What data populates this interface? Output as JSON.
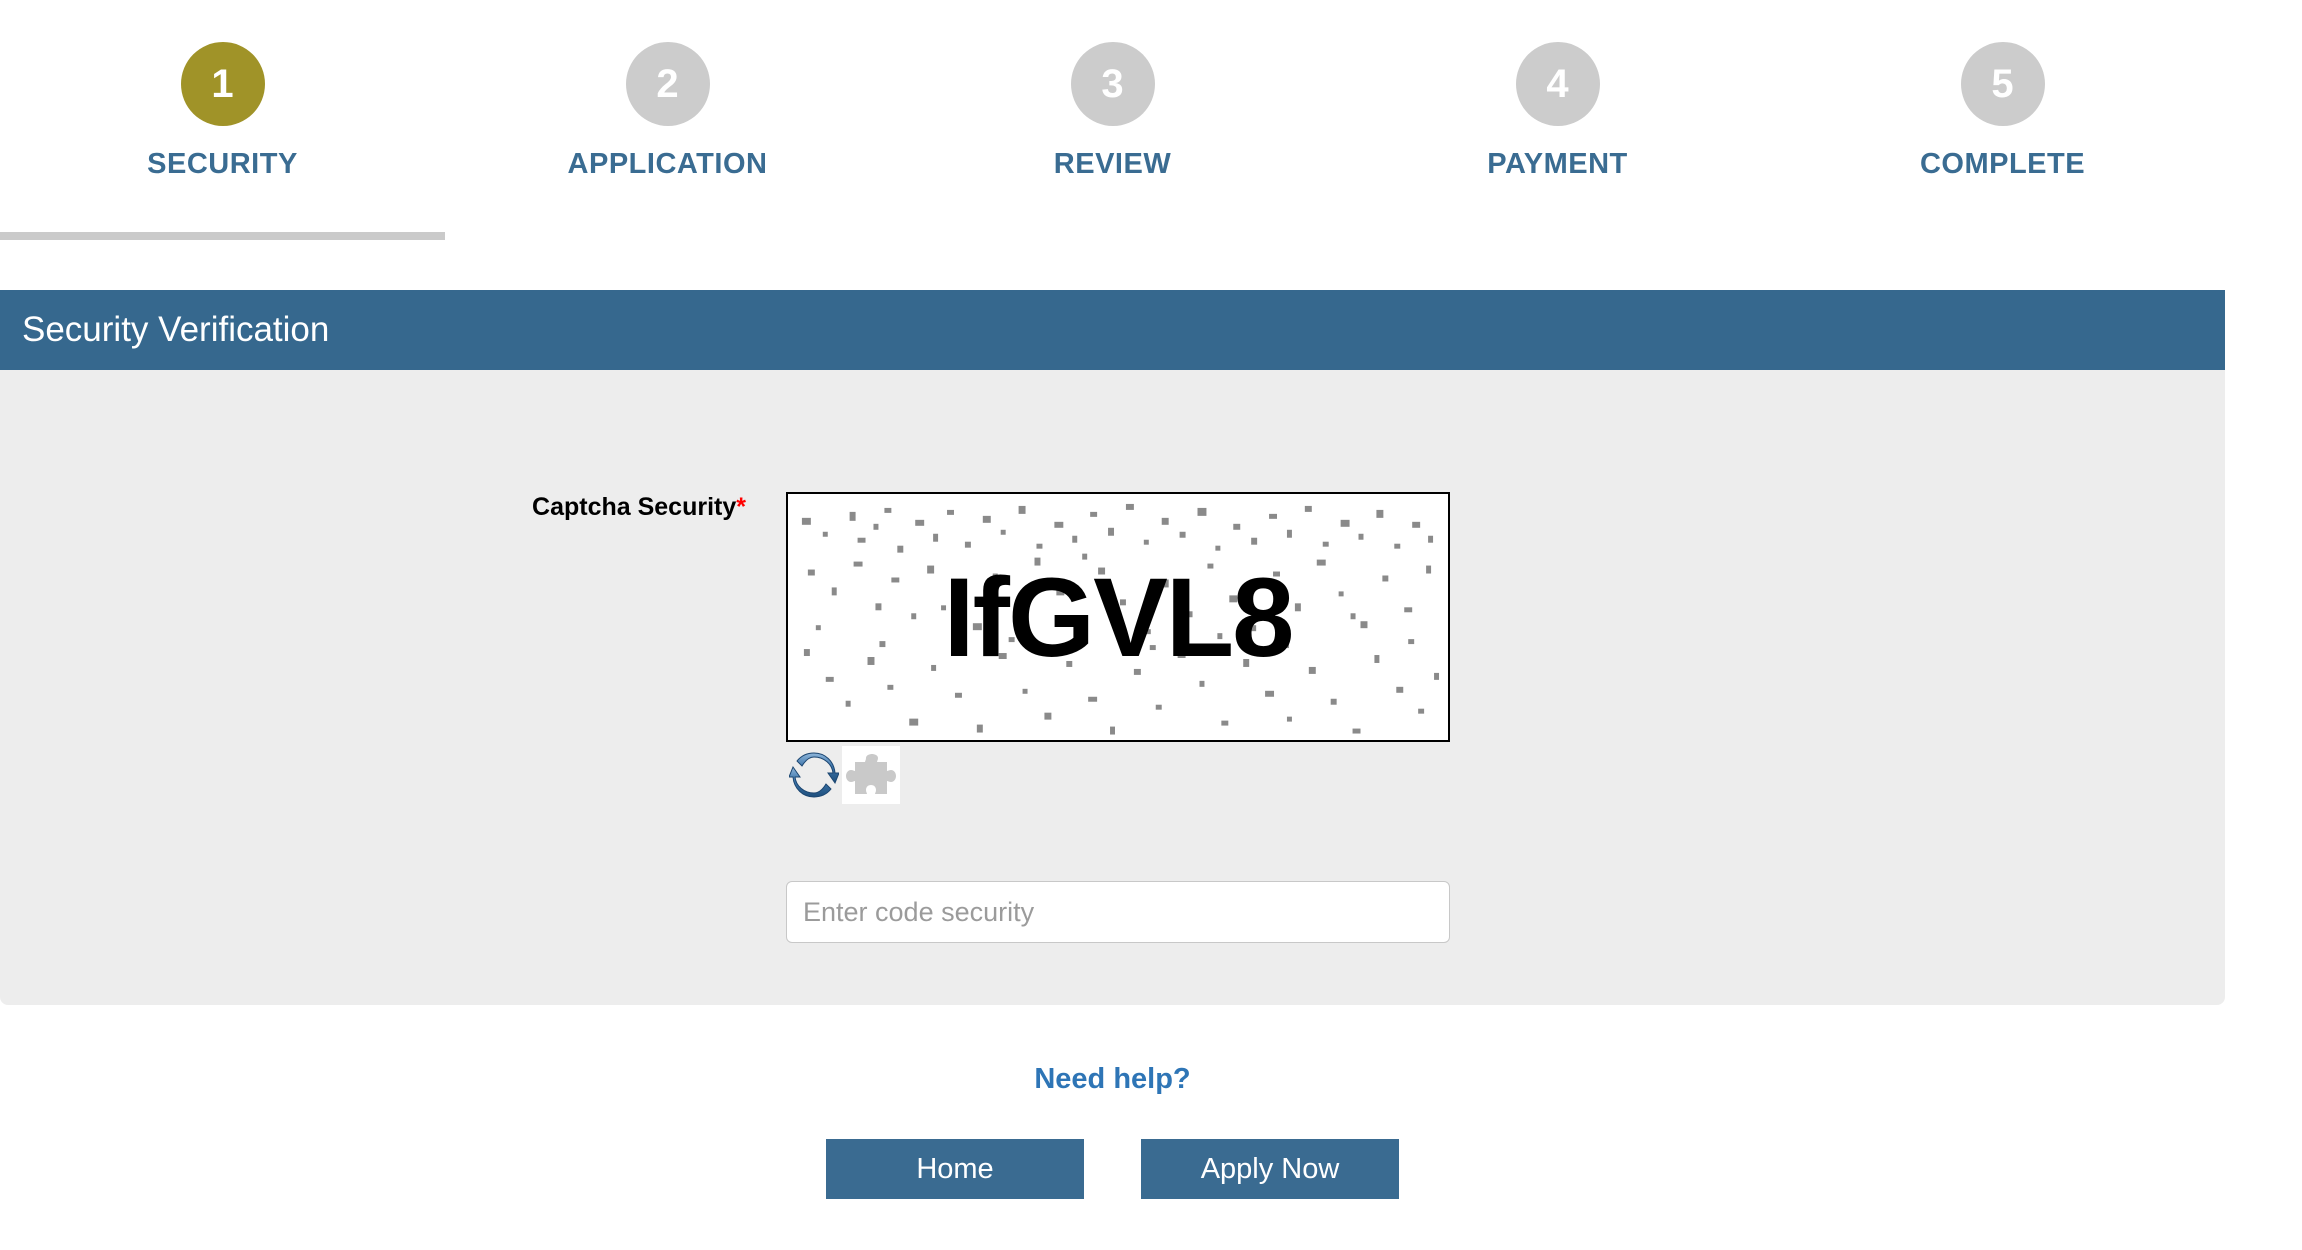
{
  "stepper": {
    "steps": [
      {
        "number": "1",
        "label": "SECURITY",
        "state": "active"
      },
      {
        "number": "2",
        "label": "APPLICATION",
        "state": "inactive"
      },
      {
        "number": "3",
        "label": "REVIEW",
        "state": "inactive"
      },
      {
        "number": "4",
        "label": "PAYMENT",
        "state": "inactive"
      },
      {
        "number": "5",
        "label": "COMPLETE",
        "state": "inactive"
      }
    ],
    "progress_percent": "20",
    "active_color": "#a09328",
    "inactive_color": "#cccccc",
    "label_color": "#3a6c92",
    "progress_color": "#cacaca"
  },
  "panel": {
    "title": "Security Verification",
    "header_color": "#36688e",
    "body_color": "#ededed"
  },
  "form": {
    "captcha_label": "Captcha Security",
    "required_marker": "*",
    "required_color": "#ff0000",
    "captcha_code": "IfGVL8",
    "refresh_icon": "refresh-icon",
    "plugin_icon": "puzzle-piece-icon",
    "input_placeholder": "Enter code security",
    "input_value": ""
  },
  "footer": {
    "help_link": "Need help?",
    "help_color": "#2e75b6",
    "home_button": "Home",
    "apply_button": "Apply Now",
    "button_color": "#3a6b91"
  }
}
